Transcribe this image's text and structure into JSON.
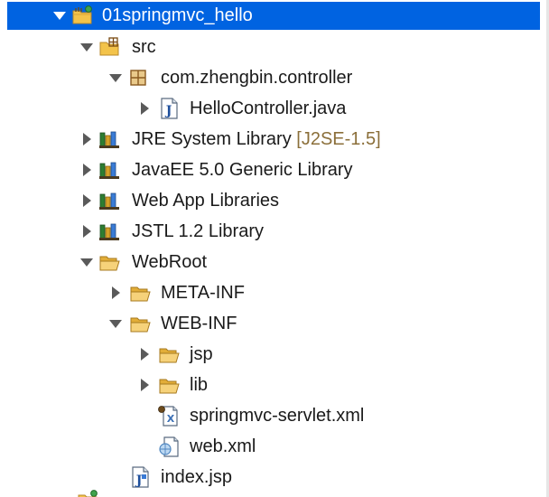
{
  "tree": {
    "project": {
      "label": "01springmvc_hello",
      "icon": "project-folder-icon"
    },
    "src": {
      "label": "src",
      "icon": "source-folder-icon"
    },
    "package": {
      "label": "com.zhengbin.controller",
      "icon": "package-icon"
    },
    "hello_controller": {
      "label": "HelloController.java",
      "icon": "java-file-icon"
    },
    "jre": {
      "label": "JRE System Library",
      "decoration": "[J2SE-1.5]",
      "icon": "library-icon"
    },
    "javaee": {
      "label": "JavaEE 5.0 Generic Library",
      "icon": "library-icon"
    },
    "webapp_libs": {
      "label": "Web App Libraries",
      "icon": "library-icon"
    },
    "jstl": {
      "label": "JSTL 1.2 Library",
      "icon": "library-icon"
    },
    "webroot": {
      "label": "WebRoot",
      "icon": "folder-icon"
    },
    "meta_inf": {
      "label": "META-INF",
      "icon": "folder-icon"
    },
    "web_inf": {
      "label": "WEB-INF",
      "icon": "folder-icon"
    },
    "jsp": {
      "label": "jsp",
      "icon": "folder-icon"
    },
    "lib": {
      "label": "lib",
      "icon": "folder-icon"
    },
    "servlet_xml": {
      "label": "springmvc-servlet.xml",
      "icon": "xml-file-icon"
    },
    "web_xml": {
      "label": "web.xml",
      "icon": "web-xml-icon"
    },
    "index_jsp": {
      "label": "index.jsp",
      "icon": "jsp-file-icon"
    }
  },
  "colors": {
    "selection": "#0063e1",
    "folder": "#f3c34a",
    "library_books": "#2e7d32",
    "decoration_text": "#8b6f3a",
    "twisty": "#5a5a5a"
  }
}
